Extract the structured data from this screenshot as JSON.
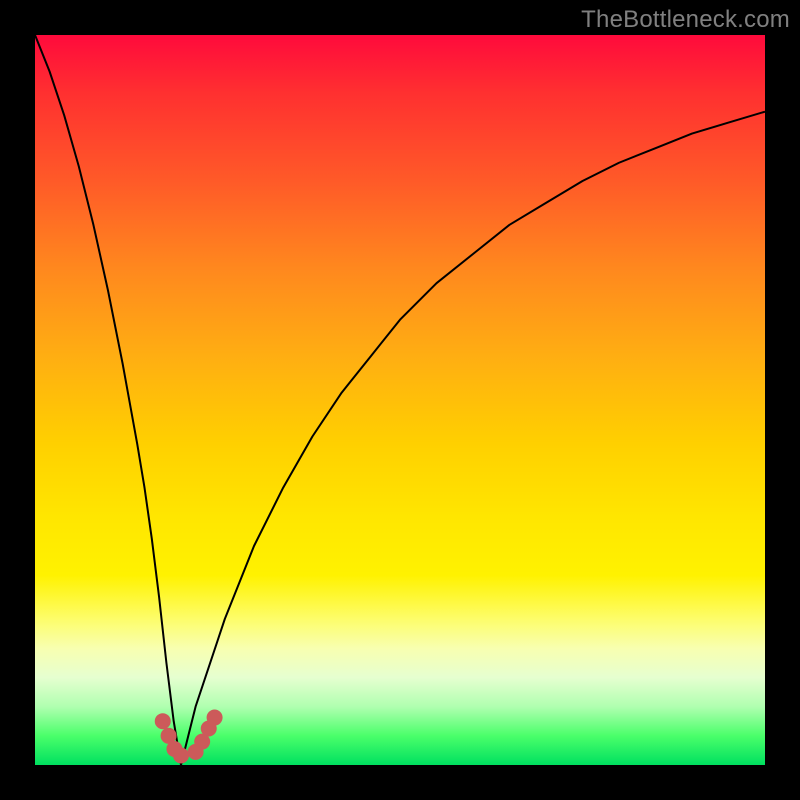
{
  "watermark": "TheBottleneck.com",
  "domain": "Chart",
  "chart_data": {
    "type": "line",
    "title": "",
    "xlabel": "",
    "ylabel": "",
    "xlim": [
      0,
      100
    ],
    "ylim": [
      0,
      100
    ],
    "note": "V-shaped curve; y≈0 at x≈20 (optimal), rises toward 100 at extremes. Values estimated from figure.",
    "series": [
      {
        "name": "curve",
        "x": [
          0,
          2,
          4,
          6,
          8,
          10,
          12,
          14,
          15,
          16,
          17,
          18,
          19,
          20,
          21,
          22,
          23,
          24,
          25,
          26,
          28,
          30,
          34,
          38,
          42,
          46,
          50,
          55,
          60,
          65,
          70,
          75,
          80,
          85,
          90,
          95,
          100
        ],
        "y": [
          100,
          95,
          89,
          82,
          74,
          65,
          55,
          44,
          38,
          31,
          23,
          14,
          6,
          0,
          4,
          8,
          11,
          14,
          17,
          20,
          25,
          30,
          38,
          45,
          51,
          56,
          61,
          66,
          70,
          74,
          77,
          80,
          82.5,
          84.5,
          86.5,
          88,
          89.5
        ]
      }
    ],
    "markers": {
      "name": "bottom-dots",
      "color": "#cc5a5a",
      "points": [
        {
          "x": 17.5,
          "y": 6
        },
        {
          "x": 18.3,
          "y": 4
        },
        {
          "x": 19.1,
          "y": 2.2
        },
        {
          "x": 20.0,
          "y": 1.3
        },
        {
          "x": 22.0,
          "y": 1.8
        },
        {
          "x": 22.9,
          "y": 3.2
        },
        {
          "x": 23.8,
          "y": 5
        },
        {
          "x": 24.6,
          "y": 6.5
        }
      ]
    },
    "gradient_stops": [
      {
        "pos": 0,
        "color": "#ff0a3c"
      },
      {
        "pos": 20,
        "color": "#ff5a28"
      },
      {
        "pos": 44,
        "color": "#ffae12"
      },
      {
        "pos": 66,
        "color": "#ffe600"
      },
      {
        "pos": 84,
        "color": "#f8ffb0"
      },
      {
        "pos": 96,
        "color": "#4aff6a"
      },
      {
        "pos": 100,
        "color": "#00e060"
      }
    ]
  }
}
